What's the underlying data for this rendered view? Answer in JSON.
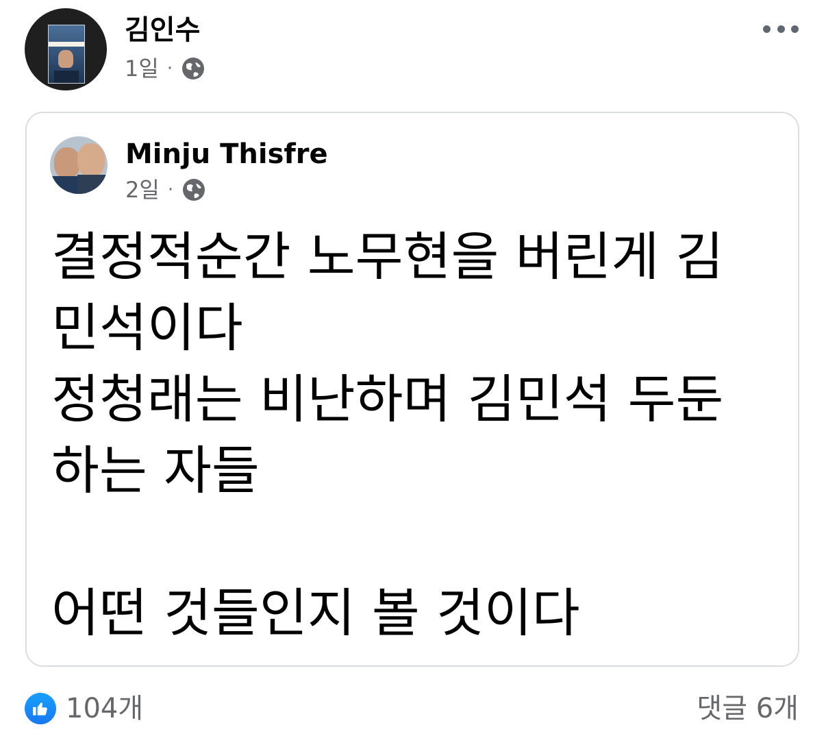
{
  "post": {
    "author": "김인수",
    "time": "1일",
    "separator": "·",
    "privacy_icon": "globe-icon",
    "more_icon": "more-options-icon"
  },
  "shared": {
    "author": "Minju Thisfre",
    "time": "2일",
    "separator": "·",
    "privacy_icon": "globe-icon",
    "lines": [
      "결정적순간 노무현을 버린게 김",
      "민석이다",
      "정청래는 비난하며 김민석 두둔",
      "하는 자들",
      "",
      "어떤 것들인지 볼 것이다"
    ]
  },
  "footer": {
    "likes": "104개",
    "like_icon": "thumbs-up-icon",
    "comments": "댓글 6개"
  },
  "colors": {
    "accent": "#1877f2",
    "muted_text": "#65676b",
    "card_border": "#dadde1"
  }
}
